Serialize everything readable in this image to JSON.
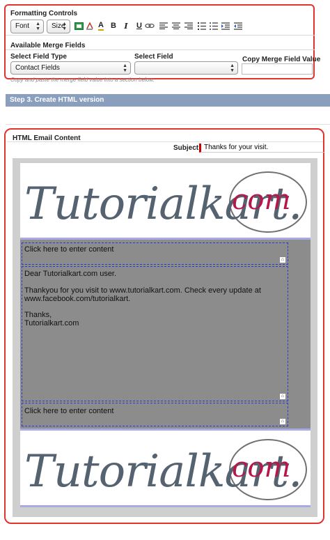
{
  "formatting": {
    "title": "Formatting Controls",
    "font_select": "Font",
    "size_select": "Size",
    "toolbar_icons": [
      "image-icon",
      "text-color-icon",
      "highlight-icon",
      "bold-icon",
      "italic-icon",
      "underline-icon",
      "link-icon",
      "align-left-icon",
      "align-center-icon",
      "align-right-icon",
      "numbered-list-icon",
      "bullet-list-icon",
      "indent-icon",
      "outdent-icon"
    ],
    "bold_glyph": "B",
    "italic_glyph": "I",
    "underline_glyph": "U",
    "text_color_glyph": "A"
  },
  "merge": {
    "title": "Available Merge Fields",
    "field_type_label": "Select Field Type",
    "field_type_value": "Contact Fields",
    "field_label": "Select Field",
    "field_value": "",
    "copy_label": "Copy Merge Field Value",
    "copy_value": "",
    "hint": "Copy and paste the merge field value into a section below."
  },
  "step": {
    "title": "Step 3. Create HTML version"
  },
  "html_content": {
    "title": "HTML Email Content",
    "subject_label": "Subject",
    "subject_value": "Thanks for your visit.",
    "logo_text": "Tutorialkart.",
    "logo_dotcom": "com",
    "block1": "Click here to enter content",
    "body_lines": [
      "Dear Tutorialkart.com user.",
      "",
      "Thankyou for you visit to www.tutorialkart.com. Check every update at",
      "www.facebook.com/tutorialkart.",
      "",
      "Thanks,",
      "Tutorialkart.com"
    ],
    "block3": "Click here to enter content"
  },
  "colors": {
    "highlight_border": "#e0332e",
    "step_bar": "#8a9fbe",
    "body_bg": "#8c8c8c",
    "accent_line": "#a9a9e6",
    "dashed_border": "#2b3bd0"
  }
}
